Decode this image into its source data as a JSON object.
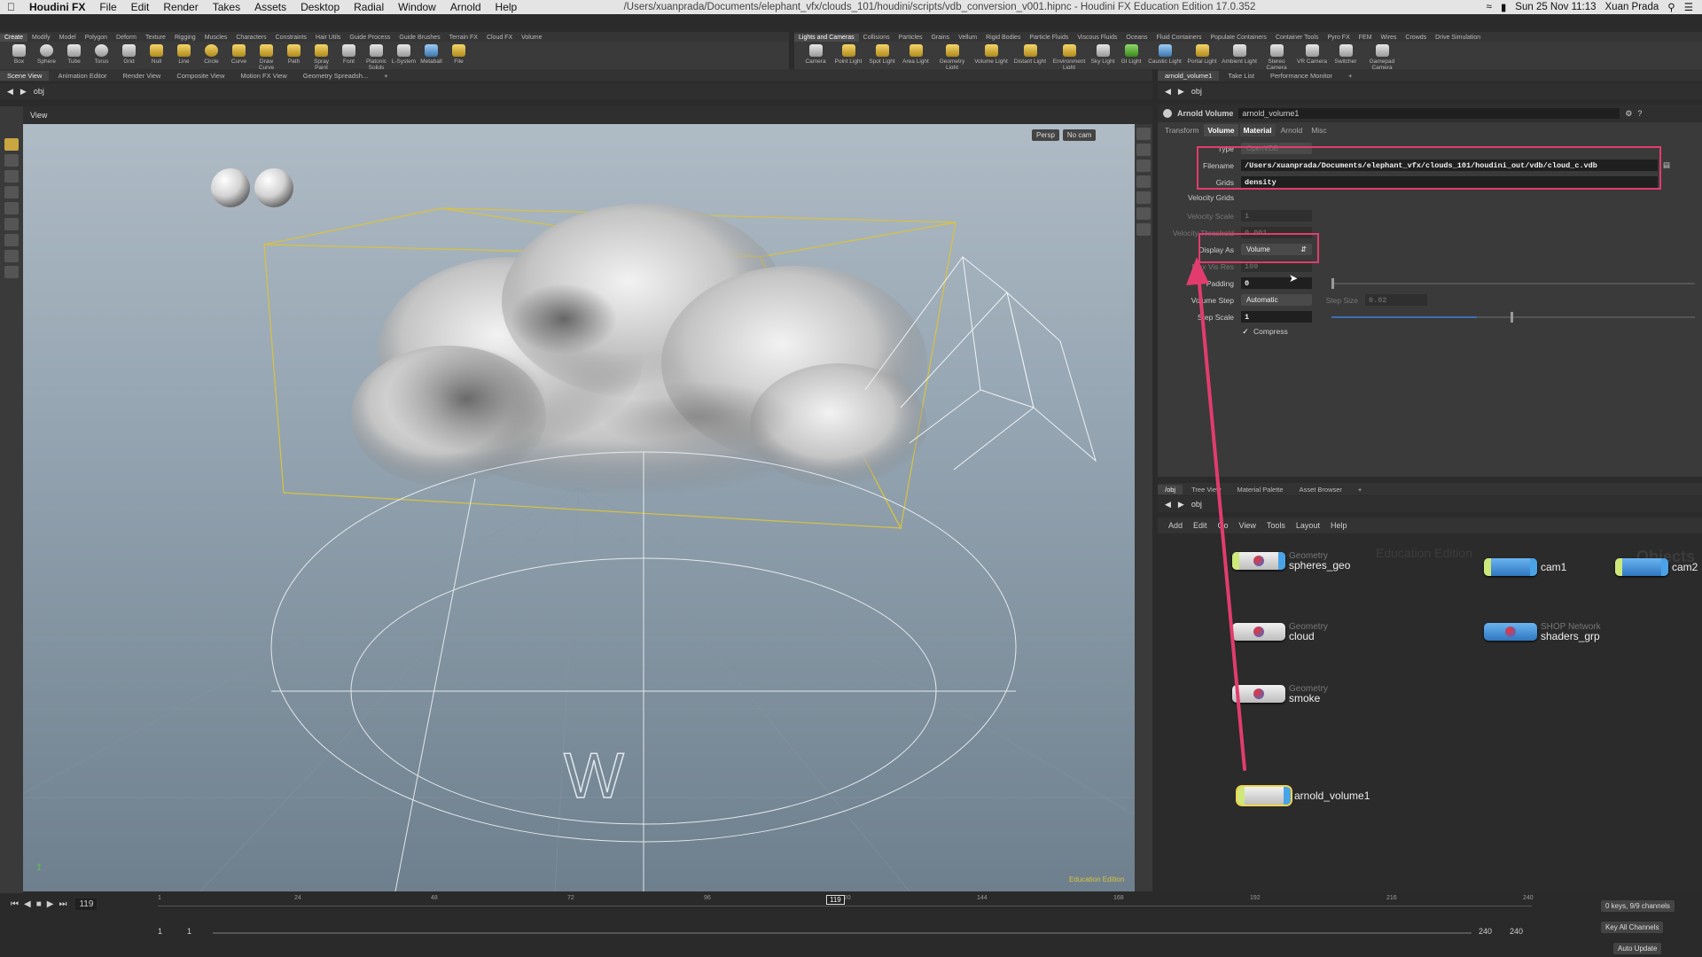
{
  "mac_menu": {
    "app": "Houdini FX",
    "items": [
      "File",
      "Edit",
      "Render",
      "Takes",
      "Assets",
      "Desktop",
      "Radial",
      "Window",
      "Arnold",
      "Help"
    ],
    "window_title": "/Users/xuanprada/Documents/elephant_vfx/clouds_101/houdini/scripts/vdb_conversion_v001.hipnc - Houdini FX Education Edition 17.0.352",
    "clock": "Sun 25 Nov  11:13",
    "user": "Xuan Prada"
  },
  "left_shelf": {
    "tabs": [
      "Create",
      "Modify",
      "Model",
      "Polygon",
      "Deform",
      "Texture",
      "Rigging",
      "Muscles",
      "Characters",
      "Constraints",
      "Hair Utils",
      "Guide Process",
      "Guide Brushes",
      "Terrain FX",
      "Cloud FX",
      "Volume"
    ],
    "tools": [
      "Box",
      "Sphere",
      "Tube",
      "Torus",
      "Grid",
      "Null",
      "Line",
      "Circle",
      "Curve",
      "Draw Curve",
      "Path",
      "Spray Paint",
      "Font",
      "Platonic Solids",
      "L-System",
      "Metaball",
      "File"
    ]
  },
  "right_shelf": {
    "tabs": [
      "Lights and Cameras",
      "Collisions",
      "Particles",
      "Grains",
      "Vellum",
      "Rigid Bodies",
      "Particle Fluids",
      "Viscous Fluids",
      "Oceans",
      "Fluid Containers",
      "Populate Containers",
      "Container Tools",
      "Pyro FX",
      "FEM",
      "Wires",
      "Crowds",
      "Drive Simulation"
    ],
    "tools": [
      "Camera",
      "Point Light",
      "Spot Light",
      "Area Light",
      "Geometry Light",
      "Volume Light",
      "Distant Light",
      "Environment Light",
      "Sky Light",
      "GI Light",
      "Caustic Light",
      "Portal Light",
      "Ambient Light",
      "Stereo Camera",
      "VR Camera",
      "Switcher",
      "Gamepad Camera"
    ]
  },
  "viewer": {
    "tabs": [
      "Scene View",
      "Animation Editor",
      "Render View",
      "Composite View",
      "Motion FX View",
      "Geometry Spreadsh..."
    ],
    "path": "obj",
    "label": "View",
    "persp": "Persp",
    "cam": "No cam",
    "edu_mark": "Education Edition"
  },
  "param_panel": {
    "tabs": [
      "arnold_volume1",
      "Take List",
      "Performance Monitor"
    ],
    "path": "obj",
    "node_type": "Arnold Volume",
    "node_name": "arnold_volume1",
    "sub_tabs": [
      "Transform",
      "Volume",
      "Material",
      "Arnold",
      "Misc"
    ],
    "type_label": "Type",
    "type_value": "OpenVDB",
    "filename_label": "Filename",
    "filename_value": "/Users/xuanprada/Documents/elephant_vfx/clouds_101/houdini_out/vdb/cloud_c.vdb",
    "grids_label": "Grids",
    "grids_value": "density",
    "velocity_grids_label": "Velocity Grids",
    "velocity_scale_label": "Velocity Scale",
    "velocity_scale_value": "1",
    "velocity_threshold_label": "Velocity Threshold",
    "velocity_threshold_value": "0.001",
    "display_as_label": "Display As",
    "display_as_value": "Volume",
    "max_vis_res_label": "Max Vis Res",
    "max_vis_res_value": "100",
    "padding_label": "Padding",
    "padding_value": "0",
    "volume_step_label": "Volume Step",
    "volume_step_value": "Automatic",
    "step_size_label": "Step Size",
    "step_size_value": "0.02",
    "step_scale_label": "Step Scale",
    "step_scale_value": "1",
    "compress_label": "Compress",
    "compress_checked": true
  },
  "network": {
    "tabs": [
      "/obj",
      "Tree View",
      "Material Palette",
      "Asset Browser"
    ],
    "path": "obj",
    "menu": [
      "Add",
      "Edit",
      "Go",
      "View",
      "Tools",
      "Layout",
      "Help"
    ],
    "watermark_edu": "Education Edition",
    "watermark_ctx": "Objects",
    "nodes": [
      {
        "type": "Geometry",
        "name": "spheres_geo"
      },
      {
        "type": "",
        "name": "cam1"
      },
      {
        "type": "",
        "name": "cam2"
      },
      {
        "type": "Geometry",
        "name": "cloud"
      },
      {
        "type": "SHOP Network",
        "name": "shaders_grp"
      },
      {
        "type": "Geometry",
        "name": "smoke"
      },
      {
        "type": "",
        "name": "arnold_volume1"
      }
    ]
  },
  "timeline": {
    "current_frame": "119",
    "ticks": [
      "1",
      "24",
      "48",
      "72",
      "96",
      "120",
      "144",
      "168",
      "192",
      "216",
      "240"
    ],
    "range_start": "1",
    "range_start2": "1",
    "range_end": "240",
    "range_end2": "240",
    "keys_info": "0 keys, 9/9 channels",
    "key_all": "Key All Channels",
    "auto_update": "Auto Update"
  },
  "colors": {
    "annotation": "#e23c6e",
    "bbox": "#d8c240",
    "selected_node": "#f1d54d"
  }
}
